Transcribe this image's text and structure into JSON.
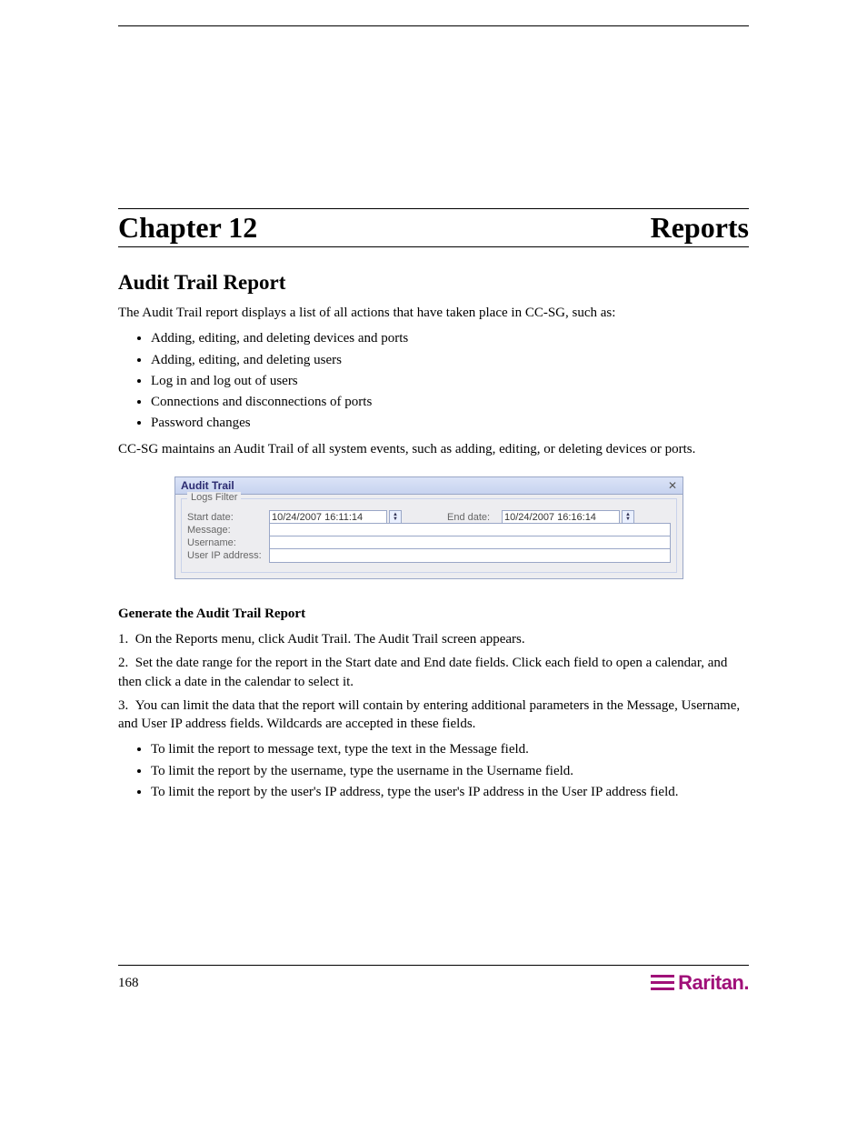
{
  "chapter": {
    "left": "Chapter 12",
    "right": "Reports"
  },
  "section": {
    "title": "Audit Trail Report",
    "para1": "The Audit Trail report displays a list of all actions that have taken place in CC-SG, such as:",
    "bullets1": [
      "Adding, editing, and deleting devices and ports",
      "Adding, editing, and deleting users",
      "Log in and log out of users",
      "Connections and disconnections of ports",
      "Password changes"
    ],
    "para2": "CC-SG maintains an Audit Trail of all system events, such as adding, editing, or deleting devices or ports.",
    "subheading": "Generate the Audit Trail Report",
    "steps": [
      "On the Reports menu, click Audit Trail. The Audit Trail screen appears.",
      "Set the date range for the report in the Start date and End date fields. Click each field to open a calendar, and then click a date in the calendar to select it.",
      "You can limit the data that the report will contain by entering additional parameters in the Message, Username, and User IP address fields. Wildcards are accepted in these fields."
    ],
    "params": [
      "To limit the report to message text, type the text in the Message field.",
      "To limit the report by the username, type the username in the Username field.",
      "To limit the report by the user's IP address, type the user's IP address in the User IP address field."
    ]
  },
  "panel": {
    "title": "Audit Trail",
    "legend": "Logs Filter",
    "startLabel": "Start date:",
    "startValue": "10/24/2007 16:11:14",
    "endLabel": "End date:",
    "endValue": "10/24/2007 16:16:14",
    "messageLabel": "Message:",
    "usernameLabel": "Username:",
    "ipLabel": "User IP address:"
  },
  "footer": {
    "page": "168",
    "brand": "Raritan."
  }
}
